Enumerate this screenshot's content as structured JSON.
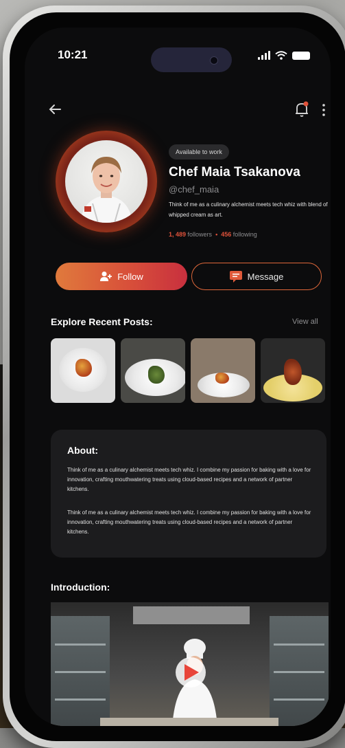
{
  "status_bar": {
    "time": "10:21"
  },
  "profile": {
    "badge": "Available to work",
    "name": "Chef Maia Tsakanova",
    "handle": "@chef_maia",
    "bio": "Think of me as a culinary alchemist meets tech whiz with blend of whipped cream as art.",
    "followers_count": "1, 489",
    "followers_label": "followers",
    "separator": "•",
    "following_count": "456",
    "following_label": "following"
  },
  "actions": {
    "follow_label": "Follow",
    "message_label": "Message"
  },
  "posts_section": {
    "title": "Explore Recent Posts:",
    "view_all_label": "View all"
  },
  "about": {
    "title": "About:",
    "paragraphs": [
      "Think of me as a culinary alchemist meets tech whiz. I combine my passion for baking with a love for innovation, crafting mouthwatering treats using cloud-based recipes and a network of partner kitchens.",
      "Think of me as a culinary alchemist meets tech whiz. I combine my passion for baking with a love for innovation, crafting mouthwatering treats using cloud-based recipes and a network of partner kitchens."
    ]
  },
  "introduction": {
    "title": "Introduction:"
  },
  "icons": {
    "back": "arrow-left-icon",
    "notifications": "bell-icon",
    "more": "kebab-menu-icon",
    "follow": "add-user-icon",
    "message": "chat-icon",
    "play": "play-icon"
  },
  "colors": {
    "accent": "#e0523a",
    "follow_gradient_start": "#e07a3c",
    "follow_gradient_end": "#c8303e",
    "screen_bg": "#0c0c0d",
    "card_bg": "#1c1c1e"
  }
}
